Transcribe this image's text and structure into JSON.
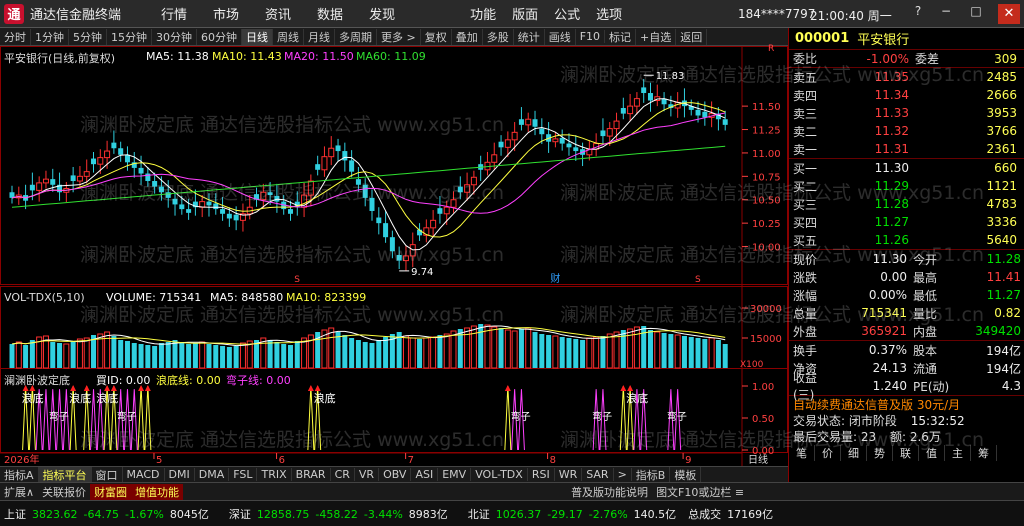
{
  "titlebar": {
    "logo": "通",
    "title": "通达信金融终端",
    "menu": [
      "行情",
      "市场",
      "资讯",
      "数据",
      "发现"
    ],
    "menu2": [
      "功能",
      "版面",
      "公式",
      "选项"
    ],
    "user": "184****7797",
    "time": "21:00:40 周一",
    "ctrl_help": "?",
    "ctrl_min": "−",
    "ctrl_max": "□",
    "ctrl_close": "✕"
  },
  "toolbar": {
    "items": [
      "分时",
      "1分钟",
      "5分钟",
      "15分钟",
      "30分钟",
      "60分钟",
      "日线",
      "周线",
      "月线",
      "多周期",
      "更多 >",
      "复权",
      "叠加",
      "多股",
      "统计",
      "画线",
      "F10",
      "标记",
      "+自选",
      "返回"
    ],
    "active_index": 6
  },
  "main_chart": {
    "header": "平安银行(日线,前复权)",
    "ma5_label": "MA5: 11.38",
    "ma10_label": "MA10: 11.43",
    "ma20_label": "MA20: 11.50",
    "ma60_label": "MA60: 11.09",
    "high_label": "11.83",
    "low_label": "9.74",
    "y_ticks": [
      "11.50",
      "11.25",
      "11.00",
      "10.75",
      "10.50",
      "10.25",
      "10.00"
    ],
    "marker_s": "S",
    "marker_cai": "财",
    "scale_top": "R",
    "scale_num": "300"
  },
  "vol_chart": {
    "header": "VOL-TDX(5,10)",
    "volume_label": "VOLUME: 715341",
    "ma5_label": "MA5: 848580",
    "ma10_label": "MA10: 823399",
    "y_ticks": [
      "30000",
      "15000"
    ],
    "unit": "X100"
  },
  "indicator": {
    "header": "澜渊卧波定底",
    "buy_label": "買ID: 0.00",
    "bottom_label": "浪底线: 0.00",
    "curve_label": "弯子线: 0.00",
    "y_ticks": [
      "1.00",
      "0.50",
      "0.00"
    ],
    "signal_a": "浪底",
    "signal_b": "弯子"
  },
  "x_axis": {
    "year": "2026年",
    "months": [
      "5",
      "6",
      "7",
      "8",
      "9"
    ],
    "period": "日线"
  },
  "colors": {
    "up": "#ff3030",
    "down": "#30d0e0",
    "ma5": "#ffffff",
    "ma10": "#ffff40",
    "ma20": "#ff40ff",
    "ma60": "#30e030",
    "bg": "#000000",
    "frame": "#8a0000"
  },
  "chart_data": {
    "type": "candlestick",
    "title": "平安银行(日线,前复权)",
    "ylim": [
      9.6,
      11.95
    ],
    "high": 11.83,
    "low": 9.74,
    "ma_last": {
      "MA5": 11.38,
      "MA10": 11.43,
      "MA20": 11.5,
      "MA60": 11.09
    },
    "close": [
      10.52,
      10.55,
      10.49,
      10.6,
      10.68,
      10.72,
      10.66,
      10.58,
      10.62,
      10.7,
      10.75,
      10.8,
      10.88,
      10.95,
      11.02,
      11.05,
      10.98,
      10.9,
      10.84,
      10.78,
      10.7,
      10.64,
      10.58,
      10.52,
      10.45,
      10.4,
      10.36,
      10.42,
      10.48,
      10.44,
      10.4,
      10.35,
      10.3,
      10.28,
      10.35,
      10.42,
      10.5,
      10.58,
      10.55,
      10.48,
      10.4,
      10.35,
      10.42,
      10.55,
      10.7,
      10.82,
      10.96,
      11.05,
      11.02,
      10.92,
      10.8,
      10.66,
      10.52,
      10.38,
      10.25,
      10.1,
      9.95,
      9.85,
      9.9,
      10.02,
      10.12,
      10.2,
      10.28,
      10.35,
      10.42,
      10.5,
      10.58,
      10.66,
      10.74,
      10.82,
      10.9,
      10.98,
      11.06,
      11.14,
      11.22,
      11.3,
      11.36,
      11.28,
      11.2,
      11.12,
      11.15,
      11.1,
      11.06,
      11.02,
      10.98,
      11.04,
      11.1,
      11.18,
      11.26,
      11.34,
      11.42,
      11.5,
      11.58,
      11.64,
      11.56,
      11.6,
      11.52,
      11.48,
      11.54,
      11.5,
      11.46,
      11.4,
      11.38,
      11.42,
      11.36,
      11.3
    ],
    "volume": [
      12000,
      13000,
      11500,
      14000,
      15500,
      16000,
      13000,
      12500,
      12000,
      13500,
      14500,
      15000,
      16500,
      17000,
      18000,
      16000,
      14000,
      13500,
      12500,
      12000,
      11500,
      11000,
      12500,
      13000,
      14000,
      13000,
      12000,
      12500,
      13000,
      12000,
      11500,
      11000,
      10500,
      11000,
      12500,
      13500,
      14000,
      15000,
      14000,
      13000,
      12000,
      11500,
      13500,
      15000,
      16500,
      18000,
      19000,
      20000,
      18000,
      16500,
      15000,
      14000,
      13000,
      12500,
      14000,
      15500,
      17000,
      18000,
      16000,
      15000,
      14500,
      15000,
      15500,
      16500,
      17000,
      18500,
      19500,
      20000,
      21000,
      22000,
      21500,
      20500,
      20000,
      19000,
      18500,
      19500,
      20000,
      18000,
      17000,
      16500,
      16000,
      15500,
      15000,
      14500,
      14000,
      15000,
      15500,
      16000,
      17000,
      18000,
      19000,
      19500,
      20500,
      21000,
      19000,
      18000,
      17500,
      17000,
      16500,
      16000,
      15500,
      15000,
      14500,
      15000,
      14000,
      12000
    ]
  },
  "quote": {
    "code": "000001",
    "name": "平安银行",
    "weibi_label": "委比",
    "weibi_value": "-1.00%",
    "weicha_label": "委差",
    "weicha_value": "309",
    "asks": [
      {
        "label": "卖五",
        "price": "11.35",
        "vol": "2485"
      },
      {
        "label": "卖四",
        "price": "11.34",
        "vol": "2666"
      },
      {
        "label": "卖三",
        "price": "11.33",
        "vol": "3953"
      },
      {
        "label": "卖二",
        "price": "11.32",
        "vol": "3766"
      },
      {
        "label": "卖一",
        "price": "11.31",
        "vol": "2361"
      }
    ],
    "bids": [
      {
        "label": "买一",
        "price": "11.30",
        "vol": "660"
      },
      {
        "label": "买二",
        "price": "11.29",
        "vol": "1121"
      },
      {
        "label": "买三",
        "price": "11.28",
        "vol": "4783"
      },
      {
        "label": "买四",
        "price": "11.27",
        "vol": "3336"
      },
      {
        "label": "买五",
        "price": "11.26",
        "vol": "5640"
      }
    ],
    "stats": [
      {
        "l1": "现价",
        "v1": "11.30",
        "c1": "white",
        "l2": "今开",
        "v2": "11.28",
        "c2": "green"
      },
      {
        "l1": "涨跌",
        "v1": "0.00",
        "c1": "white",
        "l2": "最高",
        "v2": "11.41",
        "c2": "red"
      },
      {
        "l1": "涨幅",
        "v1": "0.00%",
        "c1": "white",
        "l2": "最低",
        "v2": "11.27",
        "c2": "green"
      },
      {
        "l1": "总量",
        "v1": "715341",
        "c1": "yellow",
        "l2": "量比",
        "v2": "0.82",
        "c2": "yellow"
      },
      {
        "l1": "外盘",
        "v1": "365921",
        "c1": "red",
        "l2": "内盘",
        "v2": "349420",
        "c2": "green"
      }
    ],
    "stats2": [
      {
        "l1": "换手",
        "v1": "0.37%",
        "c1": "white",
        "l2": "股本",
        "v2": "194亿",
        "c2": "white"
      },
      {
        "l1": "净资",
        "v1": "24.13",
        "c1": "white",
        "l2": "流通",
        "v2": "194亿",
        "c2": "white"
      },
      {
        "l1": "收益(三)",
        "v1": "1.240",
        "c1": "white",
        "l2": "PE(动)",
        "v2": "4.3",
        "c2": "white"
      }
    ],
    "ad_text": "自动续费通达信普及版 30元/月",
    "state_label": "交易状态: 闭市阶段",
    "state_time": "15:32:52",
    "last_trade": "最后交易量: 23",
    "last_amount": "额: 2.6万",
    "right_buttons": [
      "笔",
      "价",
      "细",
      "势",
      "联",
      "值",
      "主",
      "筹"
    ]
  },
  "tabbar": {
    "items": [
      "指标A",
      "指标平台",
      "窗口",
      "MACD",
      "DMI",
      "DMA",
      "FSL",
      "TRIX",
      "BRAR",
      "CR",
      "VR",
      "OBV",
      "ASI",
      "EMV",
      "VOL-TDX",
      "RSI",
      "WR",
      "SAR",
      ">",
      "指标B",
      "模板"
    ],
    "active_index": 1
  },
  "tabbar2": {
    "items": [
      "扩展∧",
      "关联报价",
      "财富圈",
      "增值功能",
      "普及版功能说明",
      "图文F10或边栏 ≡"
    ],
    "highlight_indices": [
      2,
      3
    ]
  },
  "statusbar": [
    {
      "label": "上证",
      "value": "3823.62",
      "change": "-64.75",
      "pct": "-1.67%",
      "amount": "8045亿"
    },
    {
      "label": "深证",
      "value": "12858.75",
      "change": "-458.22",
      "pct": "-3.44%",
      "amount": "8983亿"
    },
    {
      "label": "北证",
      "value": "1026.37",
      "change": "-29.17",
      "pct": "-2.76%",
      "amount": "140.5亿"
    }
  ],
  "statusbar_tail": {
    "label": "总成交",
    "value": "17169亿"
  },
  "watermark": "澜渊卧波定底  通达信选股指标公式 www.xg51.cn"
}
